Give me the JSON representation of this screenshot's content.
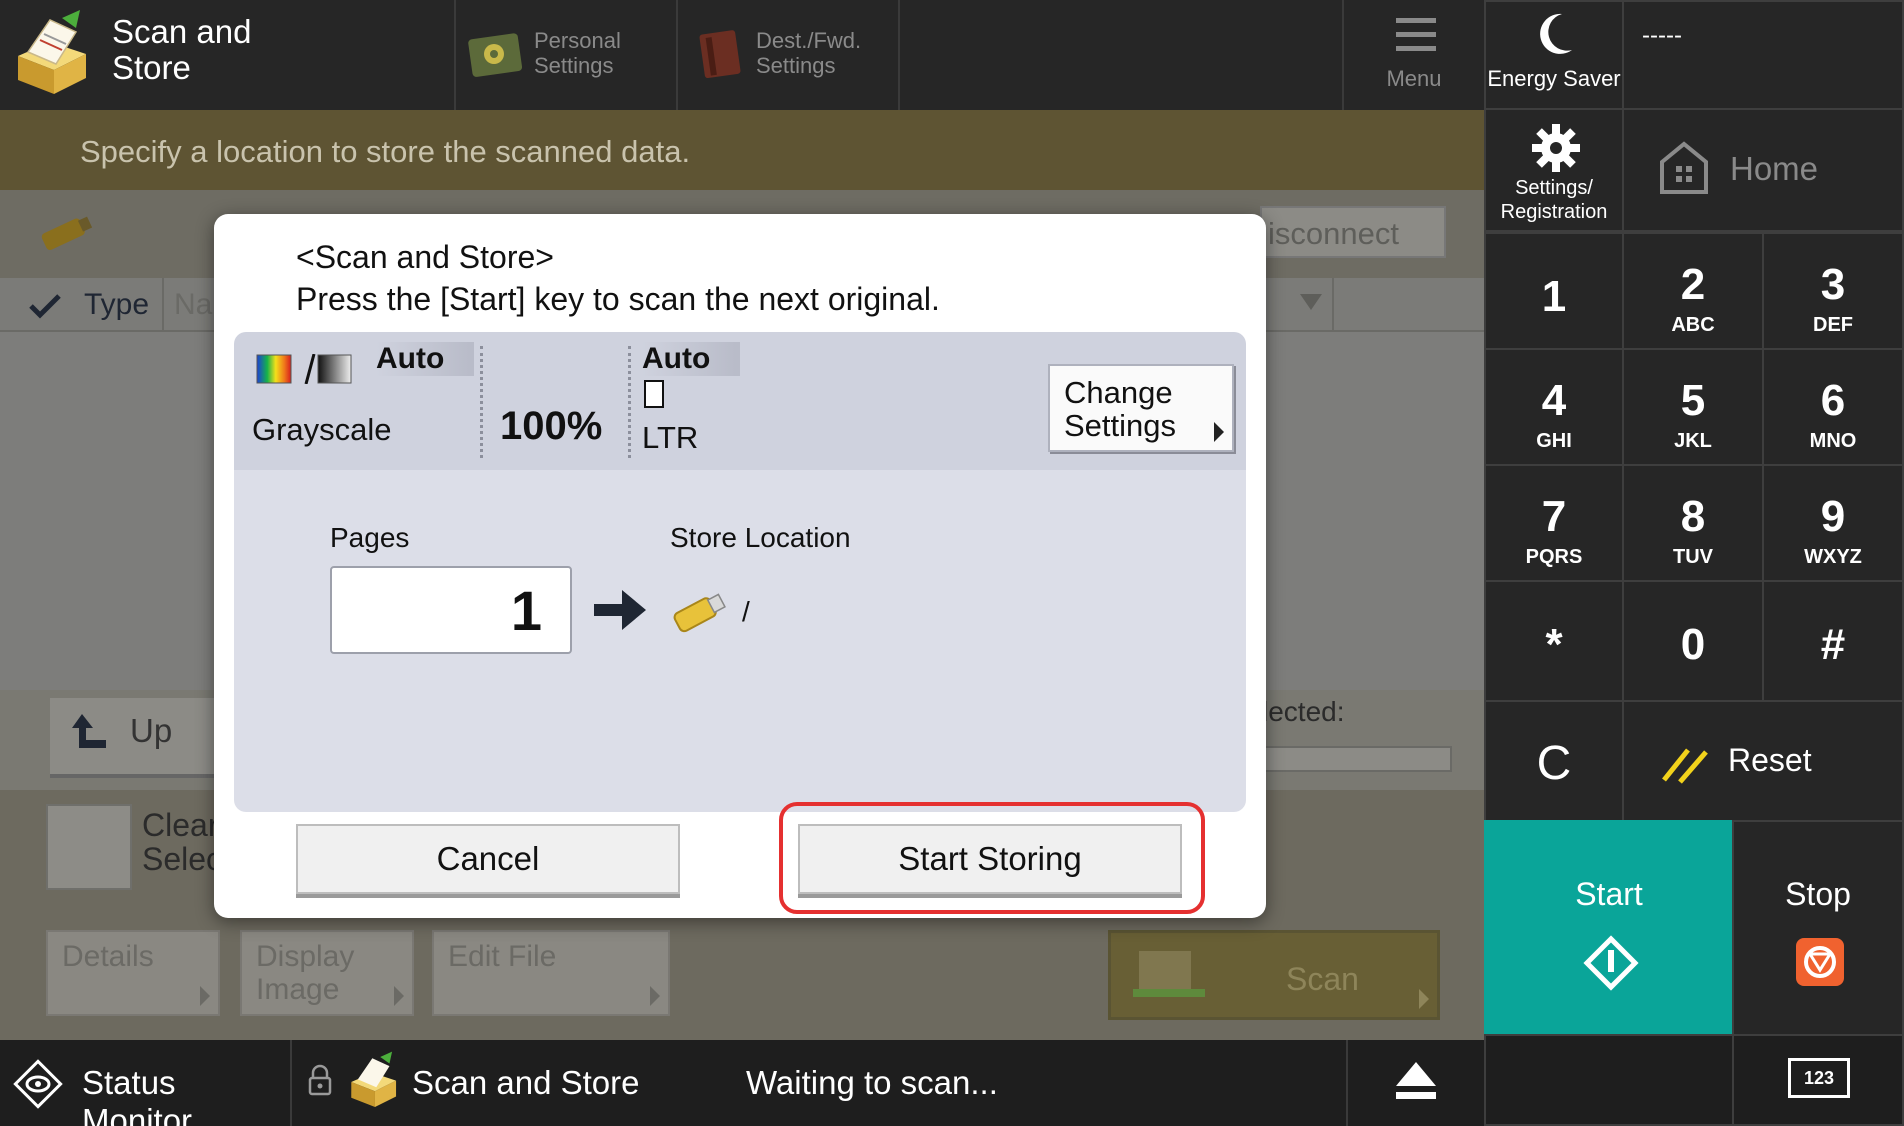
{
  "header": {
    "app_title_line1": "Scan and",
    "app_title_line2": "Store",
    "personal_settings_line1": "Personal",
    "personal_settings_line2": "Settings",
    "dest_fwd_line1": "Dest./Fwd.",
    "dest_fwd_line2": "Settings",
    "menu_label": "Menu"
  },
  "banner": {
    "message": "Specify a location to store the scanned data."
  },
  "background": {
    "disconnect_label": "isconnect",
    "type_header": "Type",
    "name_header": "Nar",
    "up_label": "Up",
    "selected_label": "lected:",
    "clear_line1": "Clear",
    "clear_line2": "Select",
    "details_label": "Details",
    "display_image_line1": "Display",
    "display_image_line2": "Image",
    "edit_file_label": "Edit File",
    "scan_label": "Scan"
  },
  "dialog": {
    "title_line1": "<Scan and Store>",
    "title_line2": "Press the [Start] key to scan the next original.",
    "color_mode_value": "Auto",
    "color_mode_label": "Grayscale",
    "zoom": "100%",
    "original_size_value": "Auto",
    "original_size_label": "LTR",
    "change_settings_line1": "Change",
    "change_settings_line2": "Settings",
    "pages_label": "Pages",
    "pages_value": "1",
    "store_location_label": "Store Location",
    "store_location_path": "/",
    "cancel_label": "Cancel",
    "start_storing_label": "Start Storing"
  },
  "statusbar": {
    "status_monitor_label": "Status Monitor",
    "job_label": "Scan and Store",
    "status_text": "Waiting to scan..."
  },
  "panel": {
    "energy_saver_label": "Energy Saver",
    "counter_text": "-----",
    "settings_line1": "Settings/",
    "settings_line2": "Registration",
    "home_label": "Home",
    "keypad": [
      {
        "d": "1",
        "l": ""
      },
      {
        "d": "2",
        "l": "ABC"
      },
      {
        "d": "3",
        "l": "DEF"
      },
      {
        "d": "4",
        "l": "GHI"
      },
      {
        "d": "5",
        "l": "JKL"
      },
      {
        "d": "6",
        "l": "MNO"
      },
      {
        "d": "7",
        "l": "PQRS"
      },
      {
        "d": "8",
        "l": "TUV"
      },
      {
        "d": "9",
        "l": "WXYZ"
      },
      {
        "d": "*",
        "l": ""
      },
      {
        "d": "0",
        "l": ""
      },
      {
        "d": "#",
        "l": ""
      }
    ],
    "clear_key": "C",
    "reset_label": "Reset",
    "start_label": "Start",
    "stop_label": "Stop",
    "numeric_badge": "123"
  },
  "colors": {
    "accent_start": "#0aa599",
    "highlight_border": "#e53030",
    "stop_icon": "#f0622f",
    "reset_icon": "#f2d21b"
  }
}
